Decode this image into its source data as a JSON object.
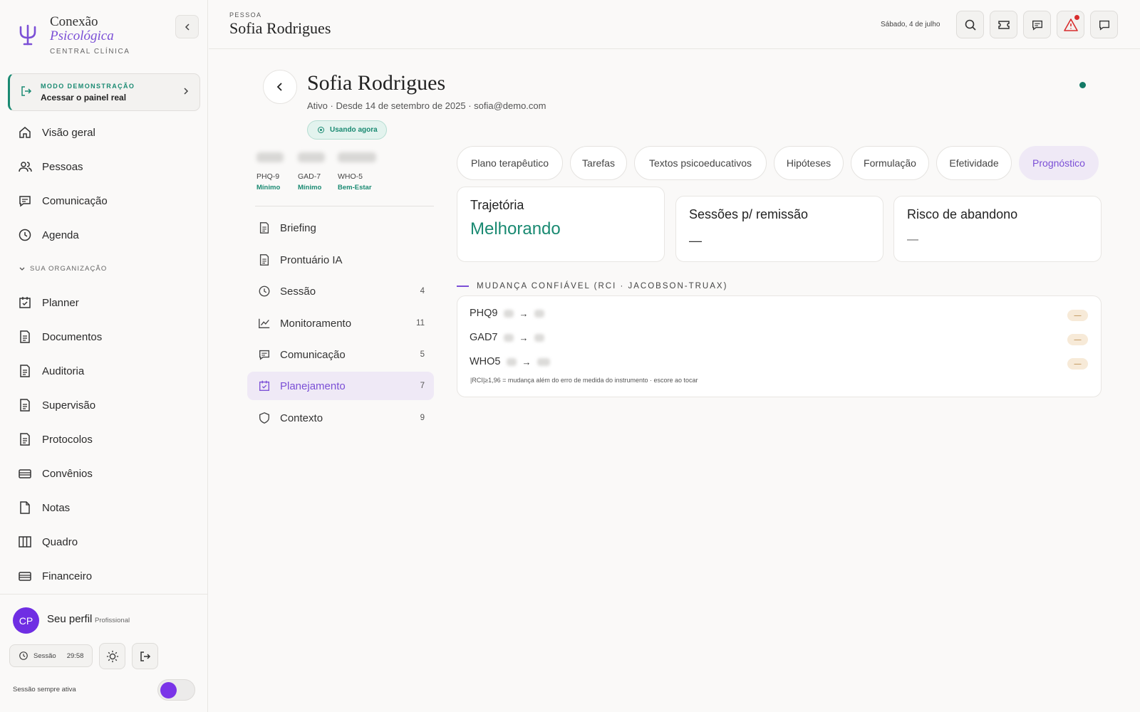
{
  "brand": {
    "name_line1": "Conexão",
    "name_line2": "Psicológica",
    "subtitle": "CENTRAL CLÍNICA"
  },
  "demo": {
    "kicker": "MODO DEMONSTRAÇÃO",
    "title": "Acessar o painel real"
  },
  "nav": {
    "items": [
      "Visão geral",
      "Pessoas",
      "Comunicação",
      "Agenda"
    ],
    "section_label": "SUA ORGANIZAÇÃO",
    "org_items": [
      "Planner",
      "Documentos",
      "Auditoria",
      "Supervisão",
      "Protocolos",
      "Convênios",
      "Notas",
      "Quadro",
      "Financeiro"
    ]
  },
  "profile": {
    "initials": "CP",
    "name": "Seu perfil",
    "role": "Profissional"
  },
  "session": {
    "label": "Sessão",
    "time": "29:58",
    "always_active_label": "Sessão sempre ativa",
    "always_active": true
  },
  "topbar": {
    "kicker": "PESSOA",
    "name": "Sofia Rodrigues",
    "date": "Sábado, 4 de julho"
  },
  "patient": {
    "name": "Sofia Rodrigues",
    "meta": "Ativo · Desde 14 de setembro de 2025 · sofia@demo.com",
    "badge": "Usando agora"
  },
  "scores": [
    {
      "name": "PHQ-9",
      "level": "Mínimo"
    },
    {
      "name": "GAD-7",
      "level": "Mínimo"
    },
    {
      "name": "WHO-5",
      "level": "Bem-Estar"
    }
  ],
  "subnav": [
    {
      "label": "Briefing",
      "count": ""
    },
    {
      "label": "Prontuário IA",
      "count": ""
    },
    {
      "label": "Sessão",
      "count": "4"
    },
    {
      "label": "Monitoramento",
      "count": "11"
    },
    {
      "label": "Comunicação",
      "count": "5"
    },
    {
      "label": "Planejamento",
      "count": "7"
    },
    {
      "label": "Contexto",
      "count": "9"
    }
  ],
  "tabs": [
    "Plano terapêutico",
    "Tarefas",
    "Textos psicoeducativos",
    "Hipóteses",
    "Formulação",
    "Efetividade",
    "Prognóstico"
  ],
  "active_tab": "Prognóstico",
  "cards": {
    "trajectory": {
      "title": "Trajetória",
      "value": "Melhorando"
    },
    "sessions": {
      "title": "Sessões p/ remissão",
      "value": "—"
    },
    "dropout": {
      "title": "Risco de abandono",
      "value": "—"
    }
  },
  "rci": {
    "header": "MUDANÇA CONFIÁVEL (RCI · JACOBSON-TRUAX)",
    "rows": [
      {
        "name": "PHQ9",
        "arrow": "→",
        "badge": "—"
      },
      {
        "name": "GAD7",
        "arrow": "→",
        "badge": "—"
      },
      {
        "name": "WHO5",
        "arrow": "→",
        "badge": "—"
      }
    ],
    "footnote": "|RCI|≥1,96 = mudança além do erro de medida do instrumento · escore ao tocar"
  },
  "colors": {
    "accent_purple": "#7b4fd6",
    "accent_green": "#1a8a72",
    "alert_red": "#d82d2d",
    "avatar": "#6f2ee3"
  }
}
